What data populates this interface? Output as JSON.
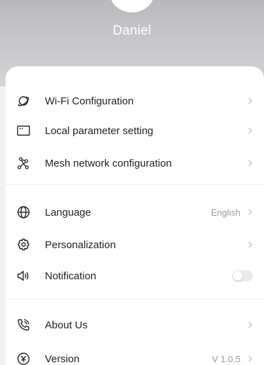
{
  "profile": {
    "name": "Daniel"
  },
  "menu": {
    "wifi_config": {
      "label": "Wi-Fi Configuration",
      "icon": "planet-icon"
    },
    "local_param": {
      "label": "Local parameter setting",
      "icon": "window-icon"
    },
    "mesh_config": {
      "label": "Mesh network configuration",
      "icon": "network-nodes-icon"
    },
    "language": {
      "label": "Language",
      "value": "English",
      "icon": "globe-icon"
    },
    "personalization": {
      "label": "Personalization",
      "icon": "gear-icon"
    },
    "notification": {
      "label": "Notification",
      "icon": "speaker-icon",
      "enabled": false
    },
    "about_us": {
      "label": "About Us",
      "icon": "phone-icon"
    },
    "version": {
      "label": "Version",
      "value": "V 1.0.5",
      "icon": "version-icon"
    }
  }
}
